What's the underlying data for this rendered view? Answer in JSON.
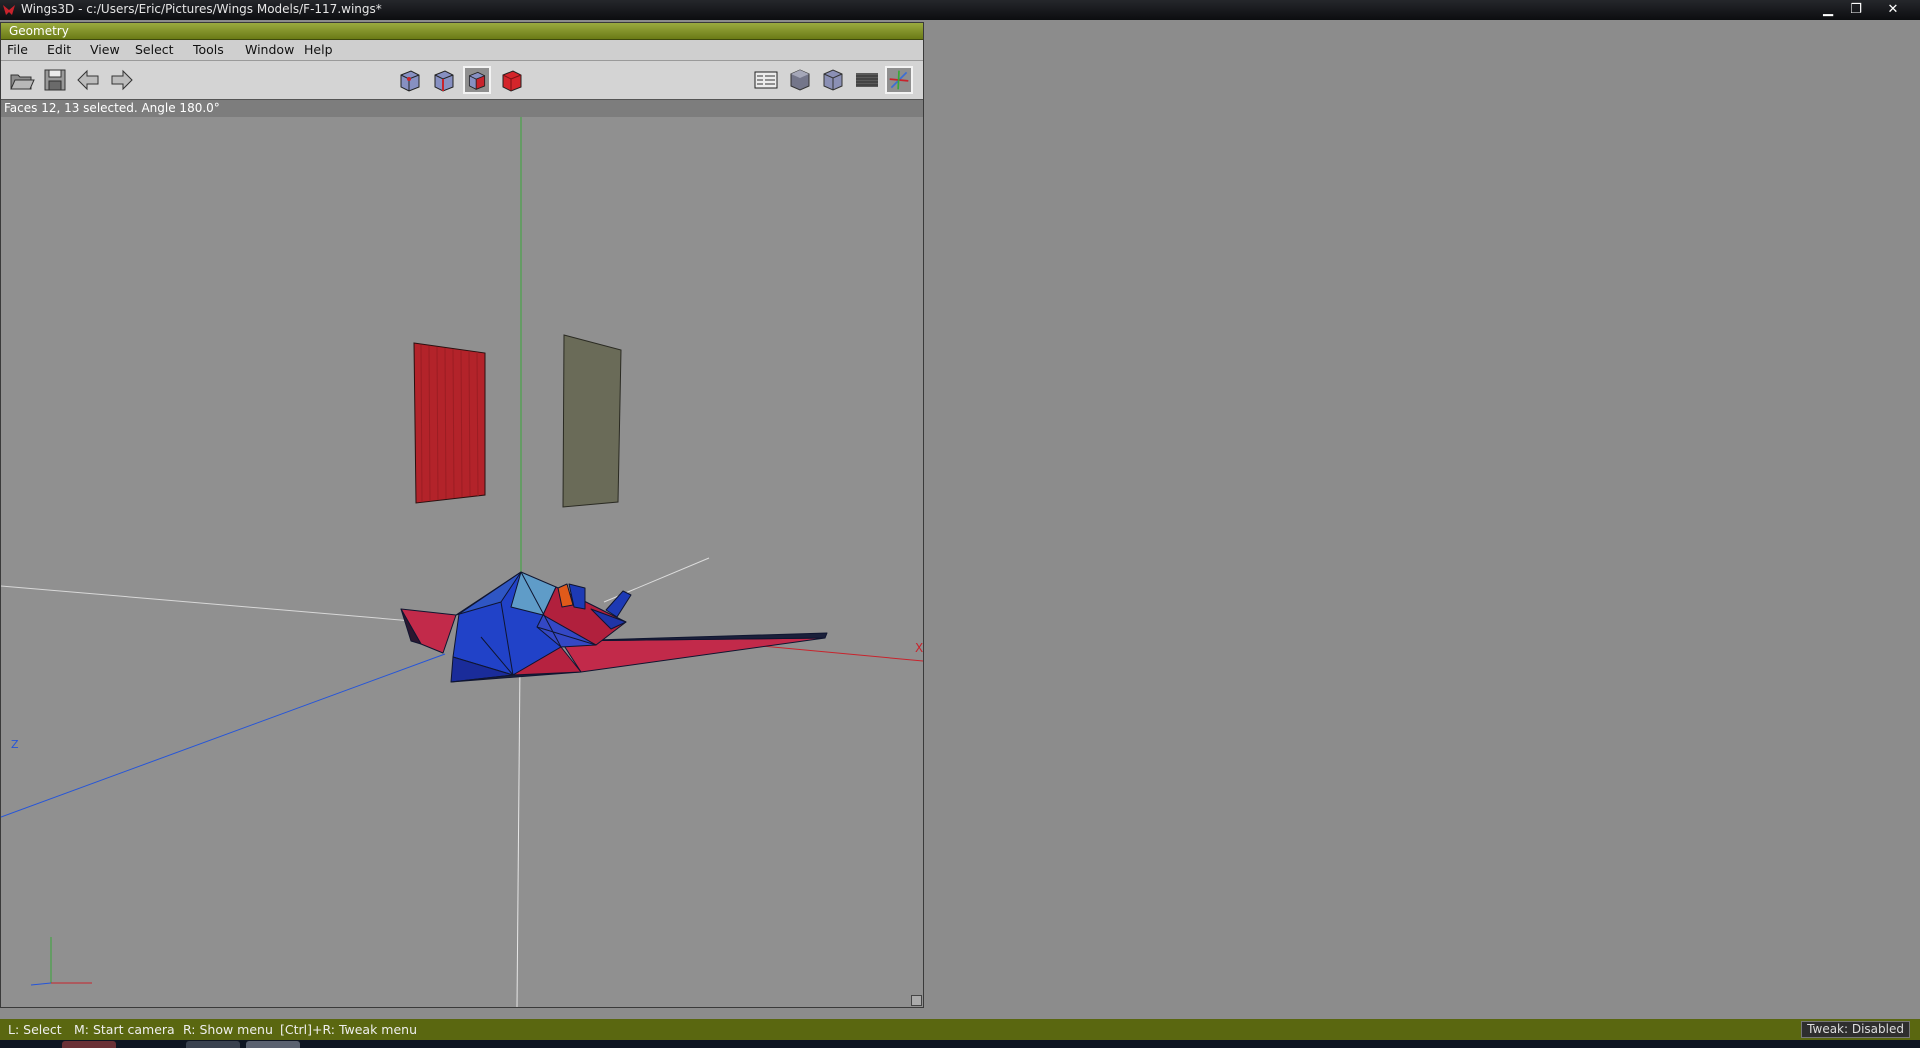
{
  "window": {
    "title": "Wings3D - c:/Users/Eric/Pictures/Wings Models/F-117.wings*",
    "controls": {
      "minimize": "▁",
      "restore": "❐",
      "close": "✕"
    }
  },
  "geometry_window": {
    "title": "Geometry",
    "menu": [
      "File",
      "Edit",
      "View",
      "Select",
      "Tools",
      "Window",
      "Help"
    ],
    "toolbar": {
      "left": [
        "open-folder-icon",
        "save-disk-icon",
        "undo-arrow-icon",
        "redo-arrow-icon"
      ],
      "selection_modes": [
        "vertex-mode-icon",
        "edge-mode-icon",
        "face-mode-icon",
        "body-mode-icon"
      ],
      "active_selection_mode": "face-mode-icon",
      "views": [
        "outliner-icon",
        "smooth-shading-icon",
        "flat-cube-icon",
        "ground-grid-icon",
        "axes-icon"
      ],
      "active_view": "axes-icon"
    },
    "info": "Faces 12, 13 selected. Angle 180.0°",
    "axis_labels": {
      "x": "X",
      "z": "Z"
    },
    "colors": {
      "accent": "#7a8a1e",
      "x_axis": "#c0242a",
      "y_axis": "#38a838",
      "z_axis": "#1e4fd1"
    }
  },
  "status": {
    "hints": [
      "L: Select",
      "M: Start camera",
      "R: Show menu",
      "[Ctrl]+R: Tweak menu"
    ],
    "tweak": "Tweak: Disabled"
  }
}
